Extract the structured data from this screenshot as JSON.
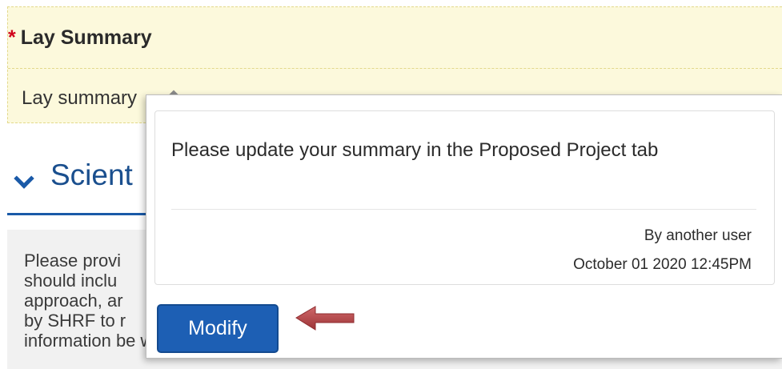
{
  "lay_summary": {
    "required_marker": "*",
    "title": "Lay Summary",
    "value": "Lay summary",
    "comment_marker_icon": "comment-indicator-icon"
  },
  "section": {
    "chevron_icon": "chevron-down-icon",
    "title": "Scient"
  },
  "instructions": {
    "lines": [
      "Please provi",
      "should inclu",
      "approach, ar",
      "by SHRF to r",
      "information be written for a multidisciplinary committee."
    ]
  },
  "comment_popup": {
    "text": "Please update your summary in the Proposed Project tab",
    "author": "By another user",
    "timestamp": "October 01 2020 12:45PM",
    "modify_label": "Modify"
  },
  "annotation": {
    "arrow_icon": "left-arrow-icon",
    "arrow_color": "#b94a4d"
  },
  "colors": {
    "field_highlight": "#fcf9dc",
    "accent_blue": "#1d5fb4",
    "required_red": "#d0021b"
  }
}
